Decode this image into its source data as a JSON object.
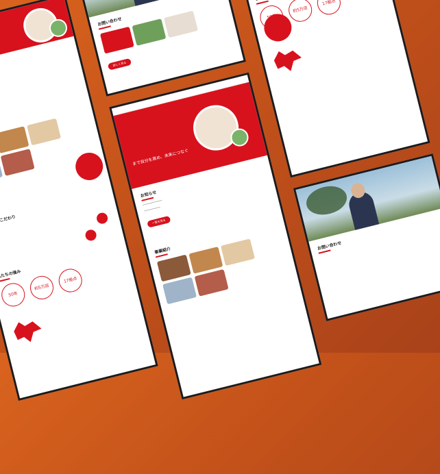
{
  "hero": {
    "tagline": "まで自分を高め、未来につなぐ"
  },
  "sections": {
    "news_title": "お知らせ",
    "business_title": "事業紹介",
    "commitment_title": "私たちのこだわり",
    "strength_title": "私たちの強み",
    "contact_title": "お問い合わせ"
  },
  "buttons": {
    "more": "一覧を見る",
    "detail": "詳しく見る"
  },
  "stats": [
    "50年",
    "約5万店",
    "17拠点"
  ],
  "colors": {
    "brand_red": "#d7121d",
    "dark_frame": "#1e1a1a",
    "bg_orange": "#d9631e"
  }
}
